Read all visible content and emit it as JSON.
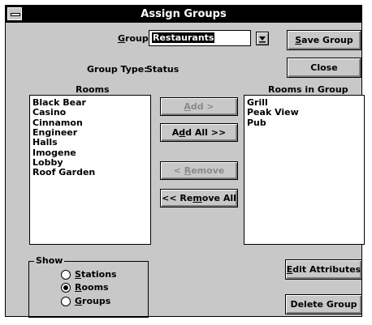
{
  "window": {
    "title": "Assign Groups"
  },
  "group": {
    "label_prefix": "",
    "label_u": "G",
    "label_rest": "roup",
    "value": "Restaurants"
  },
  "group_type": {
    "label": "Group Type:",
    "value": "Status"
  },
  "buttons": {
    "save_u": "S",
    "save_rest": "ave Group",
    "close": "Close",
    "add_u": "A",
    "add_rest": "dd >",
    "addall_pre": "A",
    "addall_u": "d",
    "addall_rest": "d All >>",
    "remove_pre": "< ",
    "remove_u": "R",
    "remove_rest": "emove",
    "removeall_pre": "<< Re",
    "removeall_u": "m",
    "removeall_rest": "ove All",
    "edit_u": "E",
    "edit_rest": "dit Attributes",
    "delete": "Delete Group"
  },
  "rooms": {
    "header": "Rooms",
    "items": [
      "Black Bear",
      "Casino",
      "Cinnamon",
      "Engineer",
      "Halls",
      "Imogene",
      "Lobby",
      "Roof Garden"
    ]
  },
  "rooms_in_group": {
    "header": "Rooms in Group",
    "items": [
      "Grill",
      "Peak View",
      "Pub"
    ]
  },
  "show": {
    "caption": "Show",
    "options": [
      {
        "u": "S",
        "rest": "tations",
        "selected": false
      },
      {
        "u": "R",
        "rest": "ooms",
        "selected": true
      },
      {
        "u": "G",
        "rest": "roups",
        "selected": false
      }
    ]
  }
}
